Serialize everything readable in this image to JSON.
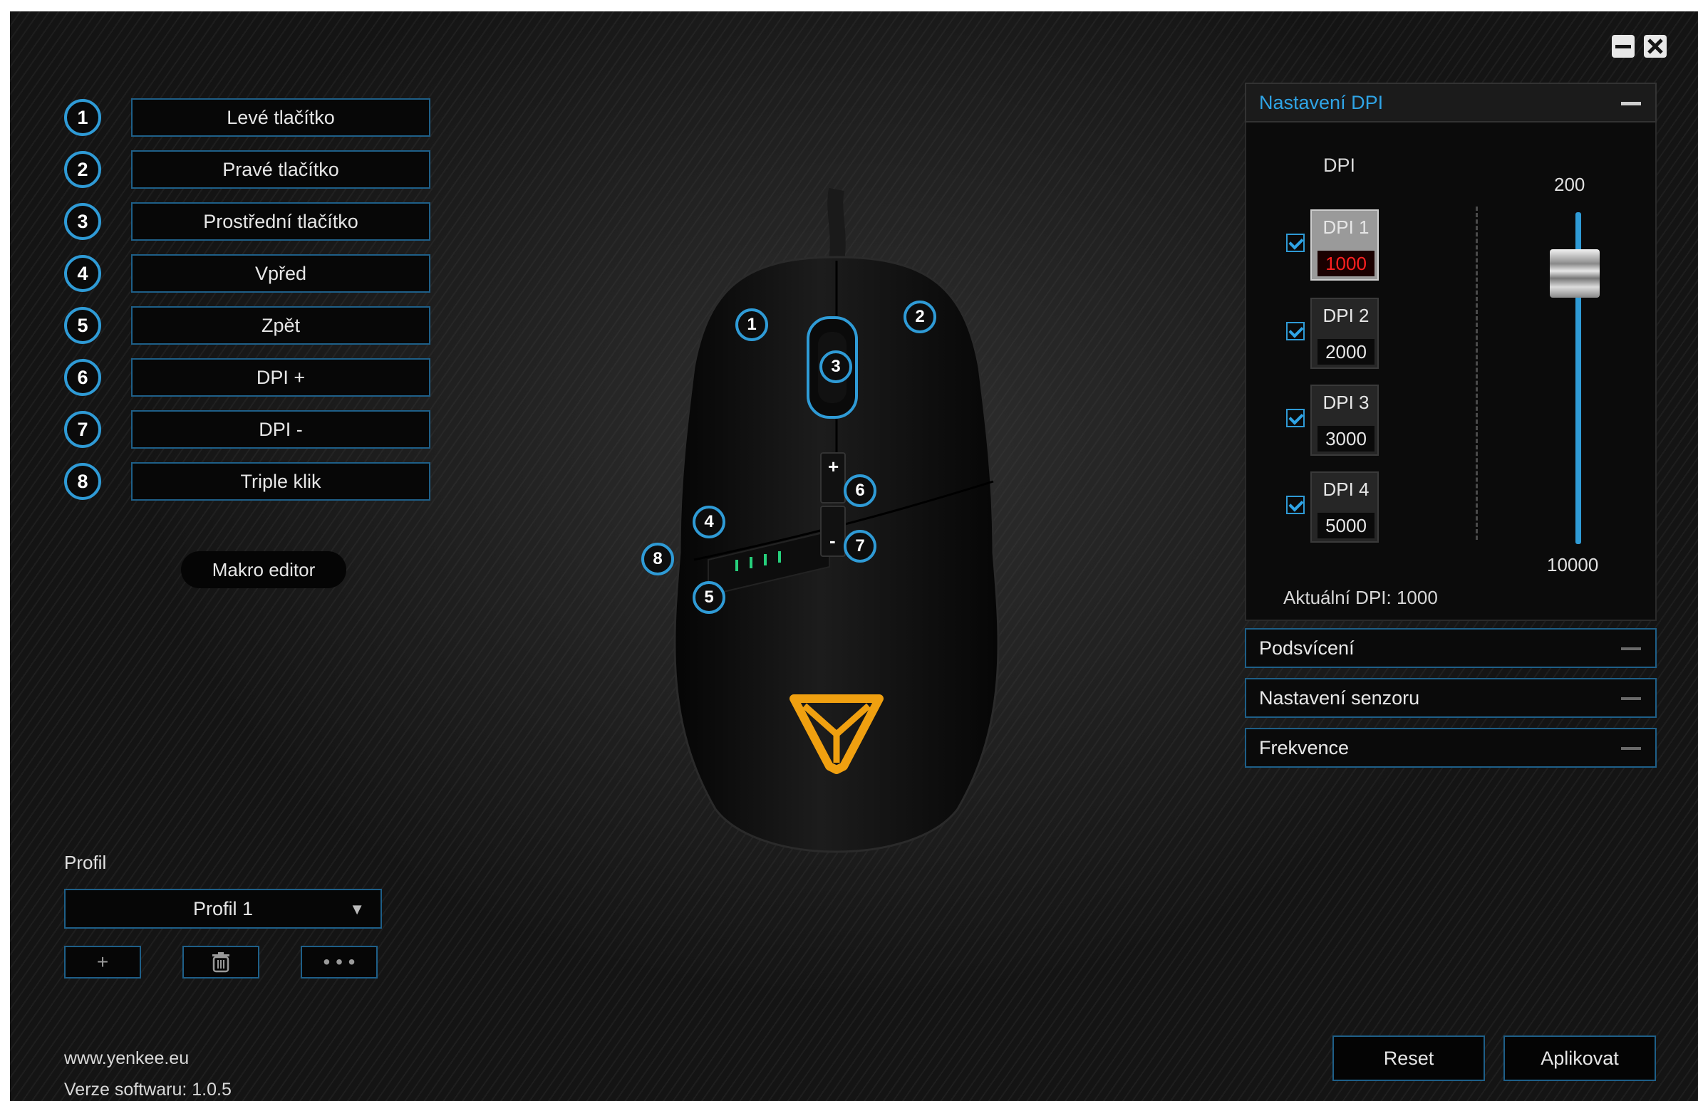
{
  "window": {
    "minimize_icon": "minimize-icon",
    "close_icon": "close-icon"
  },
  "buttons": [
    {
      "num": "1",
      "label": "Levé tlačítko"
    },
    {
      "num": "2",
      "label": "Pravé tlačítko"
    },
    {
      "num": "3",
      "label": "Prostřední tlačítko"
    },
    {
      "num": "4",
      "label": "Vpřed"
    },
    {
      "num": "5",
      "label": "Zpět"
    },
    {
      "num": "6",
      "label": "DPI +"
    },
    {
      "num": "7",
      "label": "DPI -"
    },
    {
      "num": "8",
      "label": "Triple klik"
    }
  ],
  "makro_label": "Makro editor",
  "mouse": {
    "markers": [
      "1",
      "2",
      "3",
      "4",
      "5",
      "6",
      "7",
      "8"
    ],
    "plus": "+",
    "minus": "-",
    "logo_color": "#f0a010",
    "accent_color": "#2f9bd6"
  },
  "profile": {
    "label": "Profil",
    "selected": "Profil 1",
    "add": "+",
    "delete_icon": "trash-icon",
    "more": "• • •"
  },
  "footer": {
    "website": "www.yenkee.eu",
    "version_label": "Verze softwaru:",
    "version": "1.0.5"
  },
  "dpi_panel": {
    "title": "Nastavení DPI",
    "column_label": "DPI",
    "entries": [
      {
        "name": "DPI 1",
        "value": "1000",
        "checked": true,
        "active": true
      },
      {
        "name": "DPI 2",
        "value": "2000",
        "checked": true,
        "active": false
      },
      {
        "name": "DPI 3",
        "value": "3000",
        "checked": true,
        "active": false
      },
      {
        "name": "DPI 4",
        "value": "5000",
        "checked": true,
        "active": false
      }
    ],
    "slider_top": "200",
    "slider_bottom": "10000",
    "actual_label": "Aktuální DPI:",
    "actual_value": "1000"
  },
  "collapsed_panels": [
    "Podsvícení",
    "Nastavení senzoru",
    "Frekvence"
  ],
  "actions": {
    "reset": "Reset",
    "apply": "Aplikovat"
  }
}
